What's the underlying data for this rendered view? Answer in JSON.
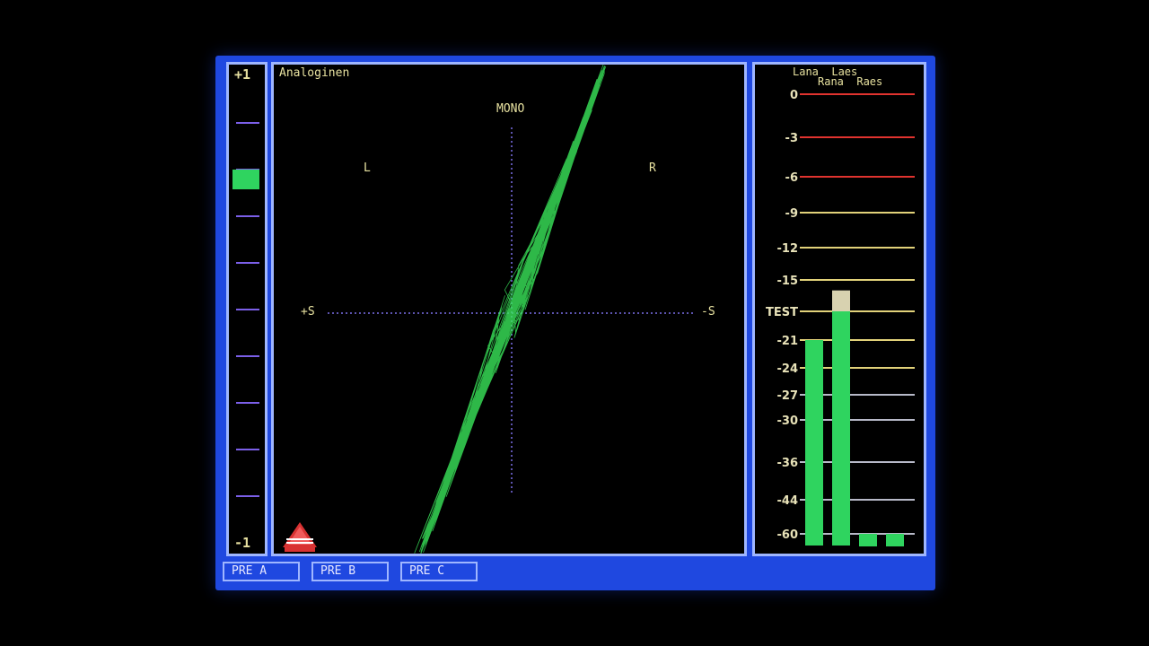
{
  "correlation": {
    "top_label": "+1",
    "bottom_label": "-1",
    "value": 0.57
  },
  "scope": {
    "title": "Analoginen",
    "mono_label": "MONO",
    "left_label": "L",
    "right_label": "R",
    "plus_s_label": "+S",
    "minus_s_label": "-S"
  },
  "meter": {
    "header_top": "Lana  Laes",
    "header_bottom": "Rana  Raes",
    "scale": [
      "0",
      "-3",
      "-6",
      "-9",
      "-12",
      "-15",
      "TEST",
      "-21",
      "-24",
      "-27",
      "-30",
      "-36",
      "-44",
      "-60"
    ],
    "scale_db": [
      0,
      -3,
      -6,
      -9,
      -12,
      -15,
      -18,
      -21,
      -24,
      -27,
      -30,
      -36,
      -44,
      -60
    ],
    "channels": [
      {
        "level_db": -24,
        "peak_db": -21
      },
      {
        "level_db": -18,
        "peak_db": -16
      },
      {
        "level_db": -60,
        "peak_db": -60
      },
      {
        "level_db": -60,
        "peak_db": -60
      }
    ],
    "colors": {
      "red": "#e0332f",
      "yellow": "#e2d27a",
      "grey": "#b7b9c8",
      "bar": "#2fd45f",
      "peak": "#d8d2b0"
    }
  },
  "presets": [
    "PRE A",
    "PRE B",
    "PRE C"
  ]
}
